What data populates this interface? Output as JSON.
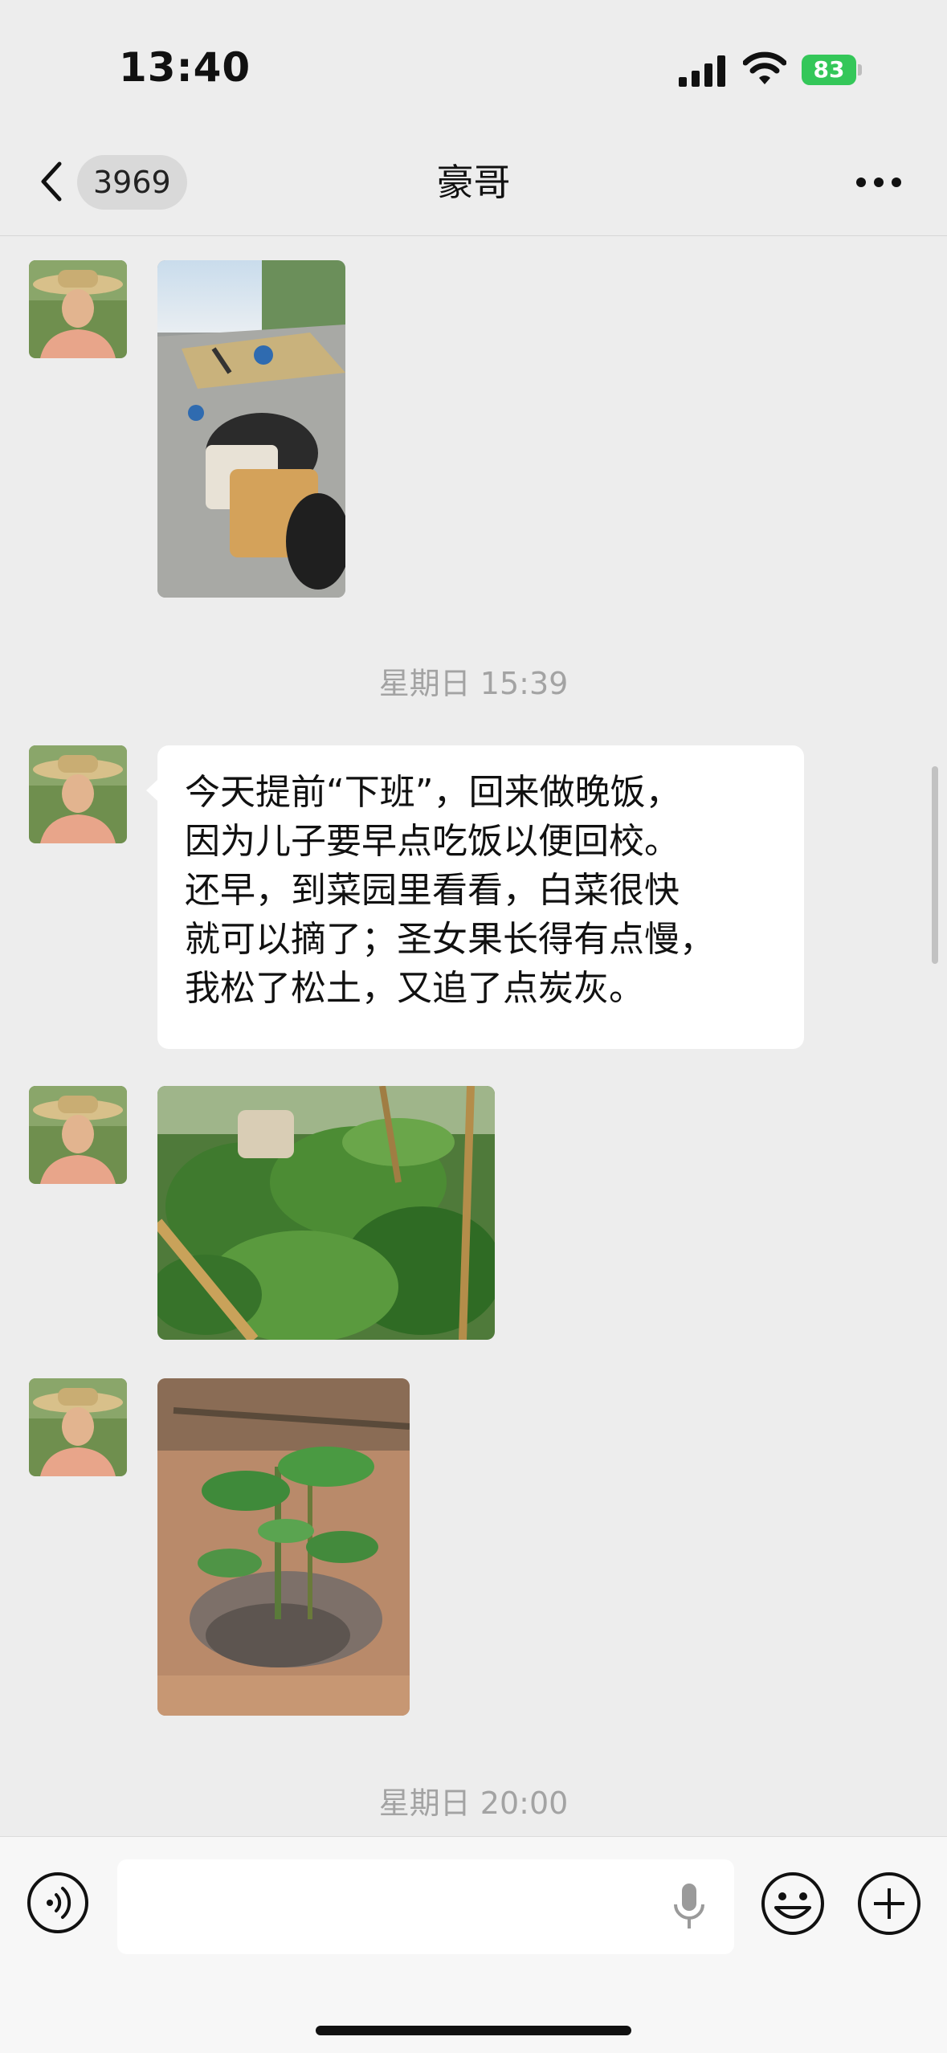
{
  "status_bar": {
    "time": "13:40",
    "battery_percent": "83",
    "icons": [
      "signal-icon",
      "wifi-icon",
      "battery-charging-icon"
    ]
  },
  "nav": {
    "unread_count": "3969",
    "title": "豪哥",
    "icons": [
      "back-chevron-icon",
      "more-dots-icon"
    ]
  },
  "messages": [
    {
      "type": "image",
      "sender": "豪哥",
      "image_desc_name": "scooter-photo"
    },
    {
      "type": "timestamp",
      "text": "星期日 15:39"
    },
    {
      "type": "text",
      "sender": "豪哥",
      "lines": [
        "今天提前“下班”，回来做晚饭，",
        "因为儿子要早点吃饭以便回校。",
        "还早，到菜园里看看，白菜很快",
        "就可以摘了；圣女果长得有点慢，",
        "我松了松土，又追了点炭灰。"
      ]
    },
    {
      "type": "image",
      "sender": "豪哥",
      "image_desc_name": "bok-choy-photo"
    },
    {
      "type": "image",
      "sender": "豪哥",
      "image_desc_name": "tomato-seedling-photo"
    },
    {
      "type": "timestamp",
      "text": "星期日 20:00"
    }
  ],
  "input_bar": {
    "text_value": "",
    "icons": [
      "voice-icon",
      "microphone-icon",
      "emoji-icon",
      "plus-icon"
    ]
  },
  "colors": {
    "background": "#ededed",
    "bubble": "#ffffff",
    "battery": "#34c759",
    "timestamp_text": "#a3a3a3"
  }
}
